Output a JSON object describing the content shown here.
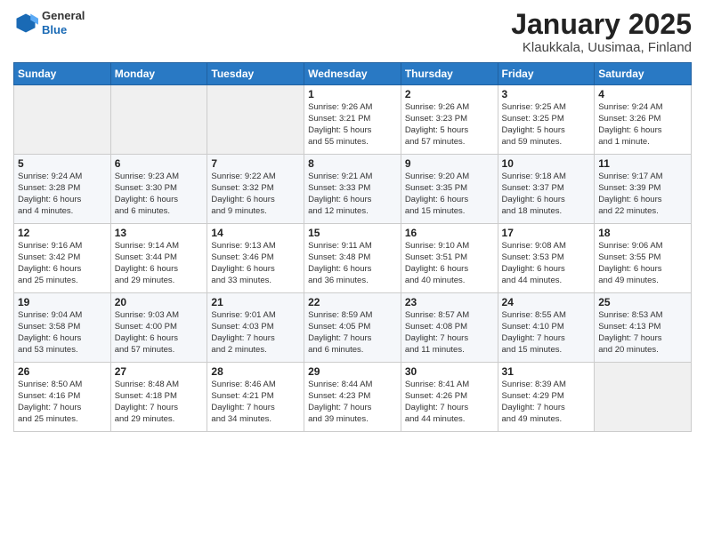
{
  "header": {
    "logo_general": "General",
    "logo_blue": "Blue",
    "month_title": "January 2025",
    "location": "Klaukkala, Uusimaa, Finland"
  },
  "weekdays": [
    "Sunday",
    "Monday",
    "Tuesday",
    "Wednesday",
    "Thursday",
    "Friday",
    "Saturday"
  ],
  "weeks": [
    [
      {
        "day": "",
        "info": ""
      },
      {
        "day": "",
        "info": ""
      },
      {
        "day": "",
        "info": ""
      },
      {
        "day": "1",
        "info": "Sunrise: 9:26 AM\nSunset: 3:21 PM\nDaylight: 5 hours\nand 55 minutes."
      },
      {
        "day": "2",
        "info": "Sunrise: 9:26 AM\nSunset: 3:23 PM\nDaylight: 5 hours\nand 57 minutes."
      },
      {
        "day": "3",
        "info": "Sunrise: 9:25 AM\nSunset: 3:25 PM\nDaylight: 5 hours\nand 59 minutes."
      },
      {
        "day": "4",
        "info": "Sunrise: 9:24 AM\nSunset: 3:26 PM\nDaylight: 6 hours\nand 1 minute."
      }
    ],
    [
      {
        "day": "5",
        "info": "Sunrise: 9:24 AM\nSunset: 3:28 PM\nDaylight: 6 hours\nand 4 minutes."
      },
      {
        "day": "6",
        "info": "Sunrise: 9:23 AM\nSunset: 3:30 PM\nDaylight: 6 hours\nand 6 minutes."
      },
      {
        "day": "7",
        "info": "Sunrise: 9:22 AM\nSunset: 3:32 PM\nDaylight: 6 hours\nand 9 minutes."
      },
      {
        "day": "8",
        "info": "Sunrise: 9:21 AM\nSunset: 3:33 PM\nDaylight: 6 hours\nand 12 minutes."
      },
      {
        "day": "9",
        "info": "Sunrise: 9:20 AM\nSunset: 3:35 PM\nDaylight: 6 hours\nand 15 minutes."
      },
      {
        "day": "10",
        "info": "Sunrise: 9:18 AM\nSunset: 3:37 PM\nDaylight: 6 hours\nand 18 minutes."
      },
      {
        "day": "11",
        "info": "Sunrise: 9:17 AM\nSunset: 3:39 PM\nDaylight: 6 hours\nand 22 minutes."
      }
    ],
    [
      {
        "day": "12",
        "info": "Sunrise: 9:16 AM\nSunset: 3:42 PM\nDaylight: 6 hours\nand 25 minutes."
      },
      {
        "day": "13",
        "info": "Sunrise: 9:14 AM\nSunset: 3:44 PM\nDaylight: 6 hours\nand 29 minutes."
      },
      {
        "day": "14",
        "info": "Sunrise: 9:13 AM\nSunset: 3:46 PM\nDaylight: 6 hours\nand 33 minutes."
      },
      {
        "day": "15",
        "info": "Sunrise: 9:11 AM\nSunset: 3:48 PM\nDaylight: 6 hours\nand 36 minutes."
      },
      {
        "day": "16",
        "info": "Sunrise: 9:10 AM\nSunset: 3:51 PM\nDaylight: 6 hours\nand 40 minutes."
      },
      {
        "day": "17",
        "info": "Sunrise: 9:08 AM\nSunset: 3:53 PM\nDaylight: 6 hours\nand 44 minutes."
      },
      {
        "day": "18",
        "info": "Sunrise: 9:06 AM\nSunset: 3:55 PM\nDaylight: 6 hours\nand 49 minutes."
      }
    ],
    [
      {
        "day": "19",
        "info": "Sunrise: 9:04 AM\nSunset: 3:58 PM\nDaylight: 6 hours\nand 53 minutes."
      },
      {
        "day": "20",
        "info": "Sunrise: 9:03 AM\nSunset: 4:00 PM\nDaylight: 6 hours\nand 57 minutes."
      },
      {
        "day": "21",
        "info": "Sunrise: 9:01 AM\nSunset: 4:03 PM\nDaylight: 7 hours\nand 2 minutes."
      },
      {
        "day": "22",
        "info": "Sunrise: 8:59 AM\nSunset: 4:05 PM\nDaylight: 7 hours\nand 6 minutes."
      },
      {
        "day": "23",
        "info": "Sunrise: 8:57 AM\nSunset: 4:08 PM\nDaylight: 7 hours\nand 11 minutes."
      },
      {
        "day": "24",
        "info": "Sunrise: 8:55 AM\nSunset: 4:10 PM\nDaylight: 7 hours\nand 15 minutes."
      },
      {
        "day": "25",
        "info": "Sunrise: 8:53 AM\nSunset: 4:13 PM\nDaylight: 7 hours\nand 20 minutes."
      }
    ],
    [
      {
        "day": "26",
        "info": "Sunrise: 8:50 AM\nSunset: 4:16 PM\nDaylight: 7 hours\nand 25 minutes."
      },
      {
        "day": "27",
        "info": "Sunrise: 8:48 AM\nSunset: 4:18 PM\nDaylight: 7 hours\nand 29 minutes."
      },
      {
        "day": "28",
        "info": "Sunrise: 8:46 AM\nSunset: 4:21 PM\nDaylight: 7 hours\nand 34 minutes."
      },
      {
        "day": "29",
        "info": "Sunrise: 8:44 AM\nSunset: 4:23 PM\nDaylight: 7 hours\nand 39 minutes."
      },
      {
        "day": "30",
        "info": "Sunrise: 8:41 AM\nSunset: 4:26 PM\nDaylight: 7 hours\nand 44 minutes."
      },
      {
        "day": "31",
        "info": "Sunrise: 8:39 AM\nSunset: 4:29 PM\nDaylight: 7 hours\nand 49 minutes."
      },
      {
        "day": "",
        "info": ""
      }
    ]
  ]
}
